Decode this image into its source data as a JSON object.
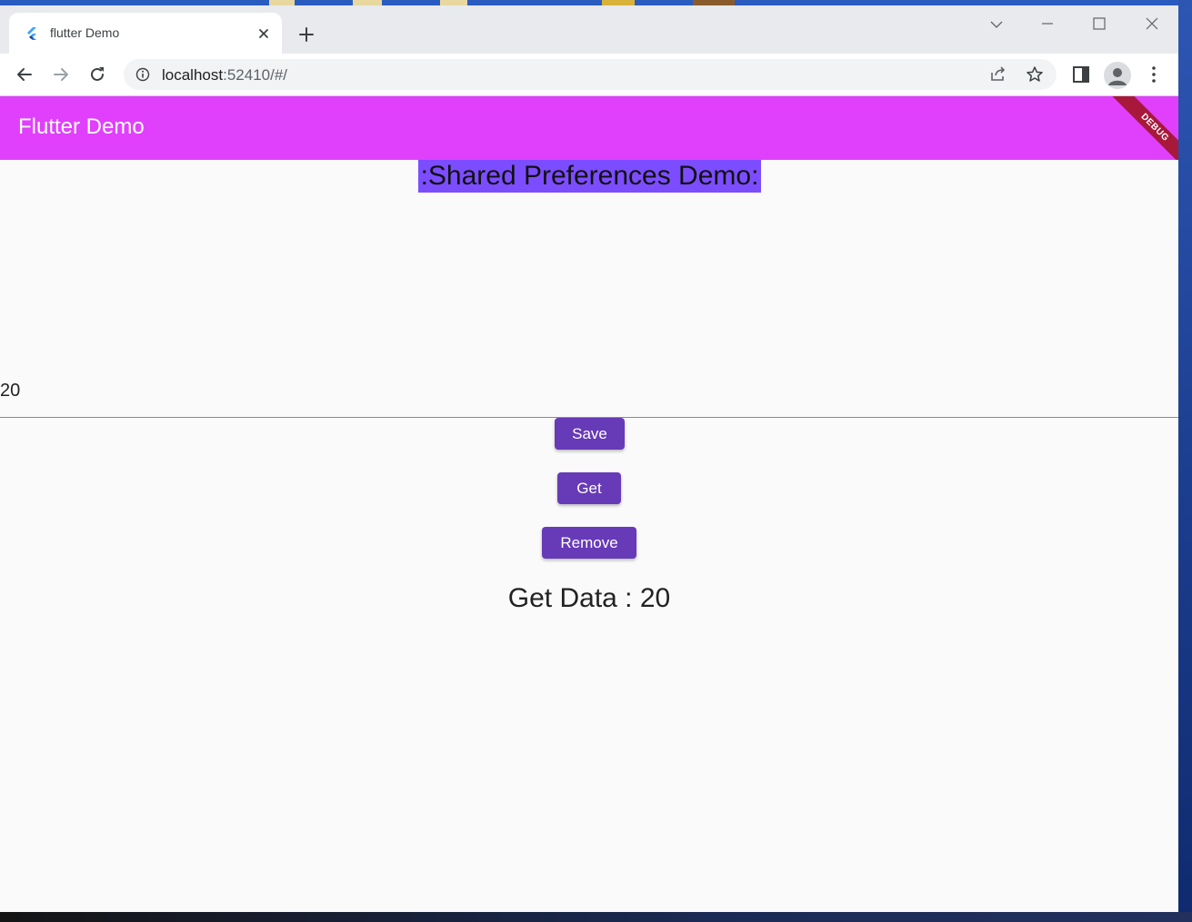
{
  "browser": {
    "tab": {
      "title": "flutter Demo",
      "favicon": "flutter-logo-icon"
    },
    "address": {
      "host": "localhost",
      "rest": ":52410/#/"
    },
    "colors": {
      "tabstrip": "#e8eaed",
      "toolbar": "#ffffff"
    }
  },
  "app": {
    "appbar_title": "Flutter Demo",
    "debug_banner": "DEBUG",
    "heading": ":Shared Preferences Demo:",
    "input_value": "20",
    "buttons": {
      "save": "Save",
      "get": "Get",
      "remove": "Remove"
    },
    "result": "Get Data : 20",
    "colors": {
      "appbar": "#e040fb",
      "heading_bg": "#7c4dff",
      "button": "#673ab7",
      "debug_banner": "#a8183b"
    }
  }
}
